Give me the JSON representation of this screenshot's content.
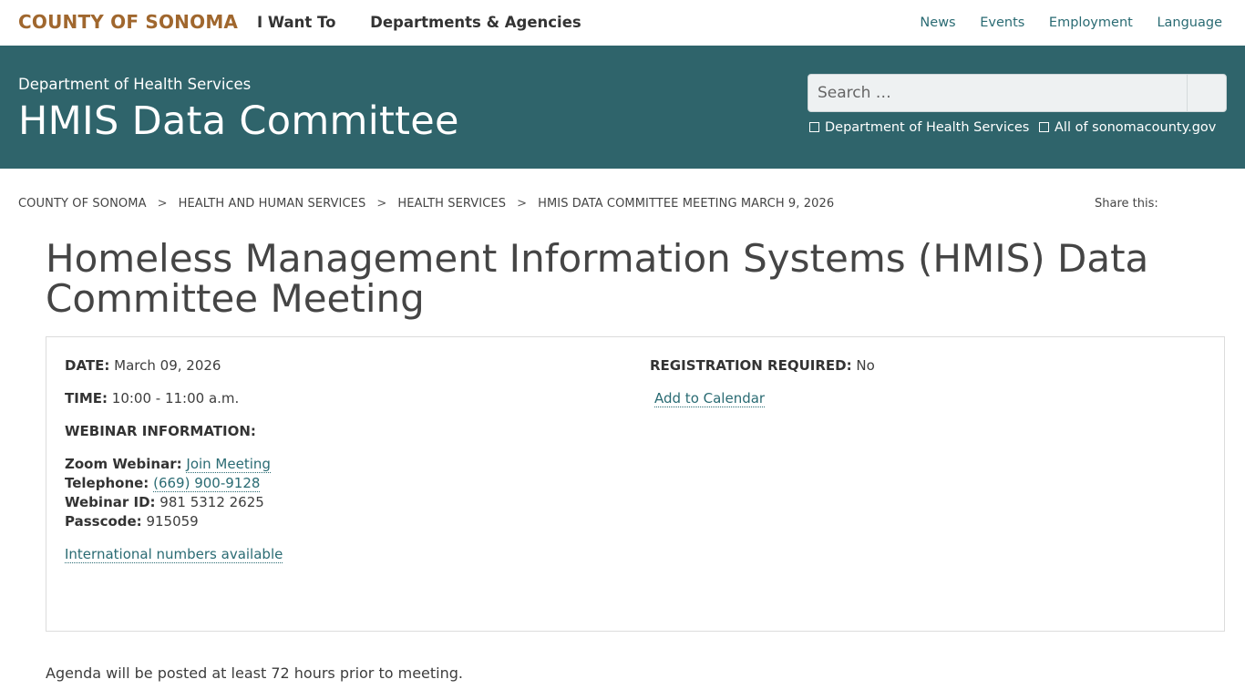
{
  "header": {
    "brand": "COUNTY OF SONOMA",
    "main_nav": [
      "I Want To",
      "Departments & Agencies"
    ],
    "util_nav": [
      "News",
      "Events",
      "Employment",
      "Language"
    ]
  },
  "banner": {
    "department": "Department of Health Services",
    "site_title": "HMIS Data Committee",
    "search_placeholder": "Search …",
    "scope_options": [
      "Department of Health Services",
      "All of sonomacounty.gov"
    ]
  },
  "breadcrumb": {
    "items": [
      "COUNTY OF SONOMA",
      "HEALTH AND HUMAN SERVICES",
      "HEALTH SERVICES",
      "HMIS DATA COMMITTEE MEETING MARCH 9, 2026"
    ],
    "separator": ">"
  },
  "share_label": "Share this:",
  "page_title": "Homeless Management Information Systems (HMIS) Data Committee Meeting",
  "event": {
    "date_label": "DATE:",
    "date_value": "March 09, 2026",
    "time_label": "TIME:",
    "time_value": "10:00 - 11:00 a.m.",
    "webinar_heading": "WEBINAR INFORMATION:",
    "zoom_label": "Zoom Webinar:",
    "zoom_link": "Join Meeting",
    "phone_label": "Telephone:",
    "phone_link": "(669) 900-9128",
    "webinar_id_label": "Webinar ID:",
    "webinar_id_value": "981 5312 2625",
    "passcode_label": "Passcode:",
    "passcode_value": "915059",
    "intl_link": "International numbers available",
    "registration_label": "REGISTRATION REQUIRED:",
    "registration_value": "No",
    "calendar_link": "Add to Calendar"
  },
  "agenda_note": "Agenda will be posted at least 72 hours prior to meeting.",
  "colors": {
    "brand": "#a0672e",
    "banner": "#2f646b",
    "link": "#2a6b73"
  }
}
